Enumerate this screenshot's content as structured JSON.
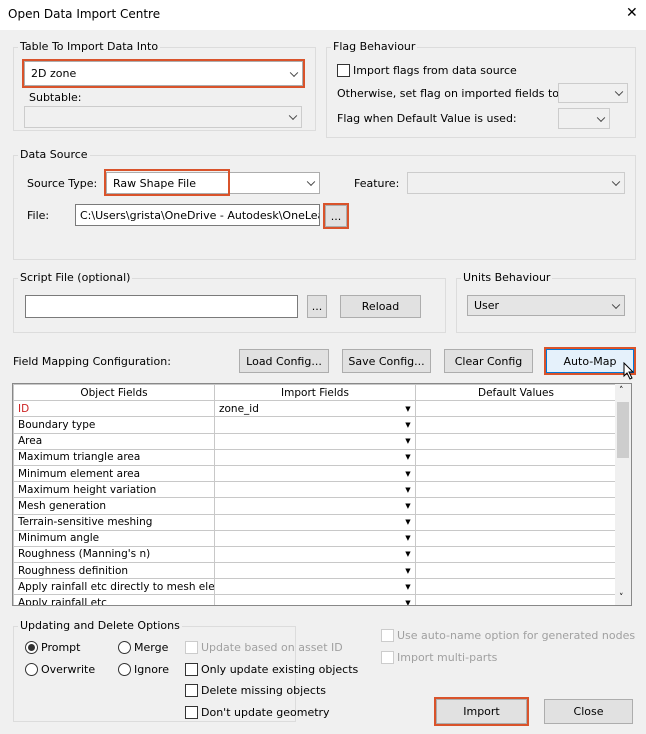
{
  "window": {
    "title": "Open Data Import Centre",
    "close": "✕"
  },
  "table_group": {
    "label": "Table To Import Data Into",
    "table_value": "2D zone",
    "subtable_label": "Subtable:",
    "subtable_value": ""
  },
  "flag_group": {
    "label": "Flag Behaviour",
    "import_flags": "Import flags from data source",
    "otherwise_label": "Otherwise, set flag on imported fields to:",
    "default_label": "Flag when Default Value is used:"
  },
  "data_source": {
    "label": "Data Source",
    "source_type_label": "Source Type:",
    "source_type_value": "Raw Shape File",
    "feature_label": "Feature:",
    "file_label": "File:",
    "file_value": "C:\\Users\\grista\\OneDrive - Autodesk\\OneLearn",
    "browse": "..."
  },
  "script": {
    "label": "Script File (optional)",
    "value": "",
    "browse": "...",
    "reload": "Reload"
  },
  "units": {
    "label": "Units Behaviour",
    "value": "User"
  },
  "mapping": {
    "label": "Field Mapping Configuration:",
    "load": "Load Config...",
    "save": "Save Config...",
    "clear": "Clear Config",
    "automap": "Auto-Map"
  },
  "grid": {
    "headers": [
      "Object Fields",
      "Import Fields",
      "Default Values"
    ],
    "rows": [
      {
        "field": "ID",
        "import": "zone_id",
        "default": ""
      },
      {
        "field": "Boundary type",
        "import": "",
        "default": ""
      },
      {
        "field": "Area",
        "import": "",
        "default": ""
      },
      {
        "field": "Maximum triangle area",
        "import": "",
        "default": ""
      },
      {
        "field": "Minimum element area",
        "import": "",
        "default": ""
      },
      {
        "field": "Maximum height variation",
        "import": "",
        "default": ""
      },
      {
        "field": "Mesh generation",
        "import": "",
        "default": ""
      },
      {
        "field": "Terrain-sensitive meshing",
        "import": "",
        "default": ""
      },
      {
        "field": "Minimum angle",
        "import": "",
        "default": ""
      },
      {
        "field": "Roughness (Manning's n)",
        "import": "",
        "default": ""
      },
      {
        "field": "Roughness definition",
        "import": "",
        "default": ""
      },
      {
        "field": "Apply rainfall etc directly to mesh elements",
        "import": "",
        "default": ""
      },
      {
        "field": "Apply rainfall etc",
        "import": "",
        "default": ""
      }
    ],
    "required_color": "#cc2222"
  },
  "update": {
    "label": "Updating and Delete Options",
    "prompt": "Prompt",
    "merge": "Merge",
    "overwrite": "Overwrite",
    "ignore": "Ignore",
    "selected": "Prompt",
    "asset_id": "Update based on asset ID",
    "only_existing": "Only update existing objects",
    "delete_missing": "Delete missing objects",
    "no_geometry": "Don't update geometry"
  },
  "extra": {
    "auto_name": "Use auto-name option for generated nodes",
    "multi_parts": "Import multi-parts"
  },
  "footer": {
    "import": "Import",
    "close": "Close"
  },
  "highlight_color": "#d9532b"
}
